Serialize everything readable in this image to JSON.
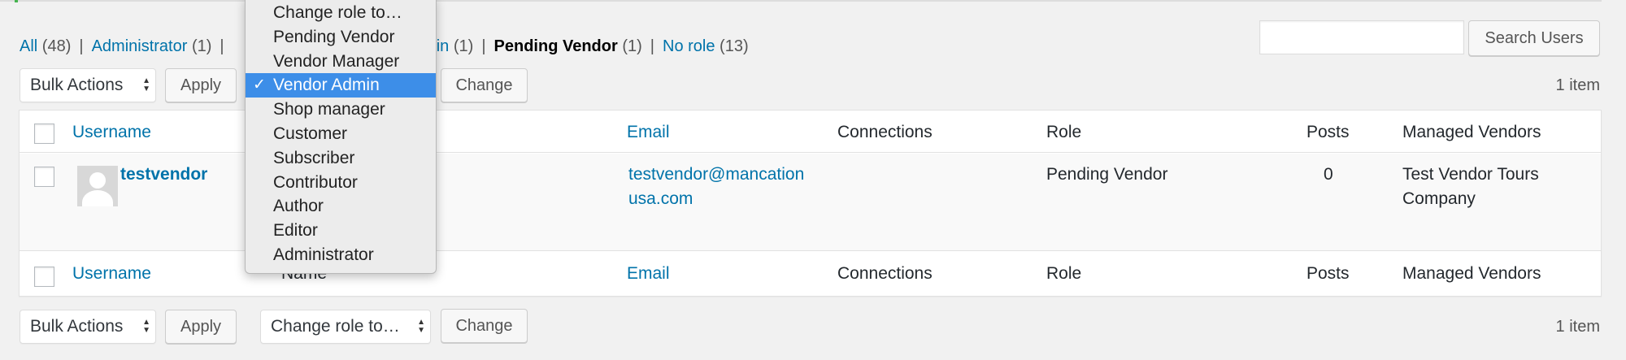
{
  "filters": {
    "all": {
      "label": "All",
      "count": "(48)"
    },
    "administrator": {
      "label": "Administrator",
      "count": "(1)"
    },
    "vendor_admin_partial": {
      "label": "Admin",
      "count": "(1)"
    },
    "pending_vendor": {
      "label": "Pending Vendor",
      "count": "(1)"
    },
    "no_role": {
      "label": "No role",
      "count": "(13)"
    },
    "separator": "|"
  },
  "search": {
    "value": "",
    "button_label": "Search Users"
  },
  "top_controls": {
    "bulk_actions": "Bulk Actions",
    "apply": "Apply",
    "change": "Change",
    "item_count": "1 item"
  },
  "bottom_controls": {
    "bulk_actions": "Bulk Actions",
    "apply": "Apply",
    "change_role": "Change role to…",
    "change": "Change",
    "item_count": "1 item"
  },
  "table": {
    "columns": {
      "username": "Username",
      "name": "Name",
      "email": "Email",
      "connections": "Connections",
      "role": "Role",
      "posts": "Posts",
      "managed_vendors": "Managed Vendors"
    },
    "rows": [
      {
        "username": "testvendor",
        "email_line1": "testvendor@mancation",
        "email_line2": "usa.com",
        "connections": "",
        "role": "Pending Vendor",
        "posts": "0",
        "managed_vendors_line1": "Test Vendor Tours",
        "managed_vendors_line2": "Company"
      }
    ]
  },
  "role_menu": {
    "check_mark": "✓",
    "selected_index": 3,
    "options": [
      "Change role to…",
      "Pending Vendor",
      "Vendor Manager",
      "Vendor Admin",
      "Shop manager",
      "Customer",
      "Subscriber",
      "Contributor",
      "Author",
      "Editor",
      "Administrator"
    ]
  },
  "colors": {
    "link": "#0073aa",
    "selected": "#3d8ee8",
    "background": "#f1f1f1"
  }
}
